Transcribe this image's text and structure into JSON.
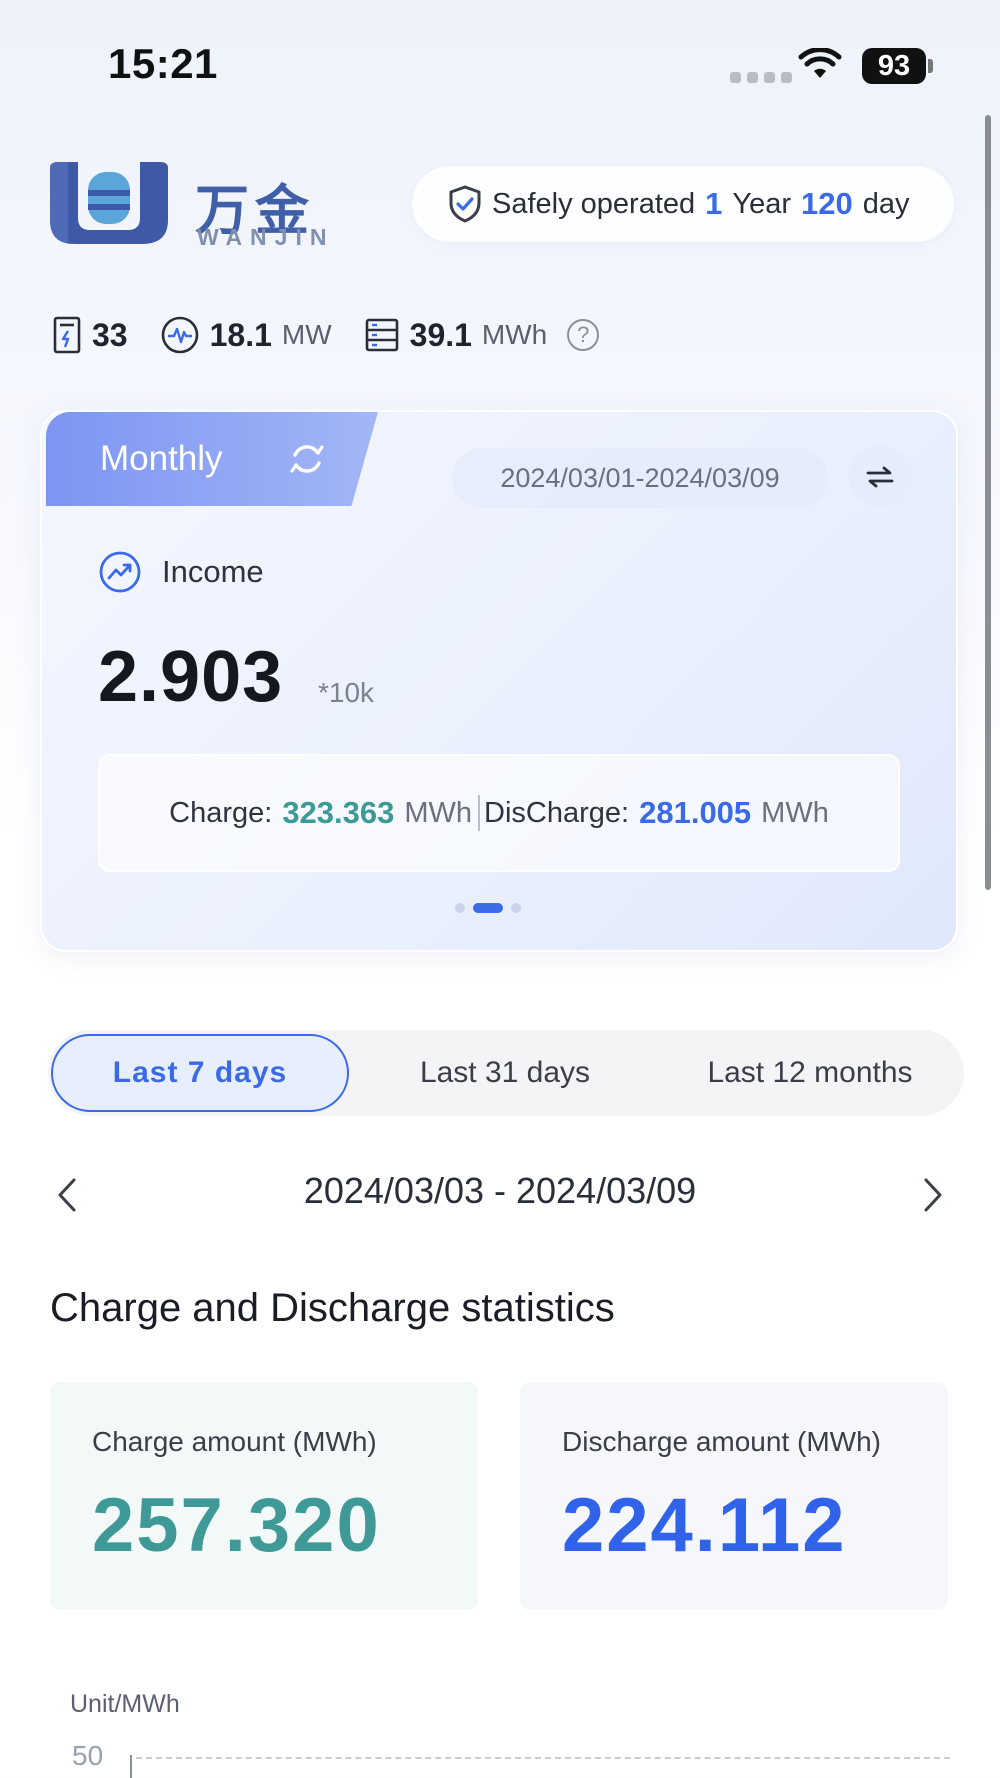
{
  "status_bar": {
    "time": "15:21",
    "battery": "93"
  },
  "header": {
    "logo_cn": "万金",
    "logo_en": "WANJIN",
    "safe": {
      "prefix": "Safely operated",
      "years": "1",
      "year_label": "Year",
      "days": "120",
      "day_label": "day"
    }
  },
  "stats": {
    "cabinets": "33",
    "power_value": "18.1",
    "power_unit": "MW",
    "capacity_value": "39.1",
    "capacity_unit": "MWh"
  },
  "income_card": {
    "tab_label": "Monthly",
    "date_range": "2024/03/01-2024/03/09",
    "income_label": "Income",
    "income_value": "2.903",
    "income_unit": "*10k",
    "charge_label": "Charge:",
    "charge_value": "323.363",
    "charge_unit": "MWh",
    "discharge_label": "DisCharge:",
    "discharge_value": "281.005",
    "discharge_unit": "MWh",
    "page_count": 3,
    "active_page": 1
  },
  "period_tabs": [
    "Last 7 days",
    "Last 31 days",
    "Last 12 months"
  ],
  "selected_period": "Last 7 days",
  "date_nav": {
    "range": "2024/03/03 - 2024/03/09"
  },
  "section_title": "Charge and Discharge statistics",
  "charge_card": {
    "label": "Charge amount (MWh)",
    "value": "257.320"
  },
  "discharge_card": {
    "label": "Discharge amount (MWh)",
    "value": "224.112"
  },
  "chart": {
    "unit_label": "Unit/MWh",
    "y_top_tick": "50"
  },
  "colors": {
    "accent": "#3a6ae8",
    "teal": "#3f9a97",
    "monthly_tab": "#7d95f2"
  }
}
